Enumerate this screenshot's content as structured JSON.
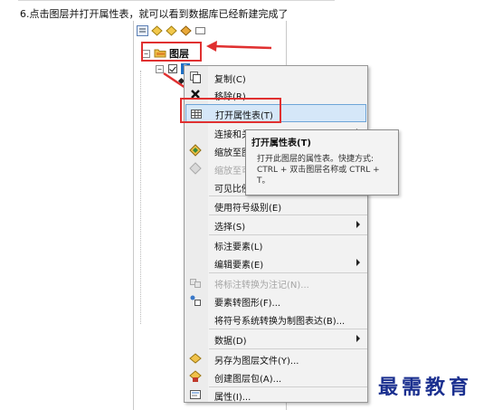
{
  "instruction": {
    "text": "6.点击图层并打开属性表，就可以看到数据库已经新建完成了"
  },
  "toc": {
    "group_label": "图层",
    "layer_chip": "P"
  },
  "menu": {
    "items": [
      {
        "label": "复制(C)",
        "icon": "copy-icon",
        "enabled": true,
        "submenu": false
      },
      {
        "label": "移除(R)",
        "icon": "remove-x-icon",
        "enabled": true,
        "submenu": false
      },
      {
        "label": "打开属性表(T)",
        "icon": "table-icon",
        "enabled": true,
        "submenu": false,
        "highlighted": true
      },
      {
        "label": "连接和关联(J)",
        "icon": "",
        "enabled": true,
        "submenu": true
      },
      {
        "label": "缩放至图层(Z)",
        "icon": "zoom-layer-icon",
        "enabled": true,
        "submenu": false
      },
      {
        "label": "缩放至可见(M)",
        "icon": "zoom-visible-icon",
        "enabled": false,
        "submenu": false
      },
      {
        "label": "可见比例范围(S)",
        "icon": "",
        "enabled": true,
        "submenu": true
      },
      {
        "label": "使用符号级别(E)",
        "icon": "",
        "enabled": true,
        "submenu": false
      },
      {
        "label": "选择(S)",
        "icon": "",
        "enabled": true,
        "submenu": true
      },
      {
        "label": "标注要素(L)",
        "icon": "",
        "enabled": true,
        "submenu": false
      },
      {
        "label": "编辑要素(E)",
        "icon": "",
        "enabled": true,
        "submenu": true
      },
      {
        "label": "将标注转换为注记(N)...",
        "icon": "convert-label-icon",
        "enabled": false,
        "submenu": false
      },
      {
        "label": "要素转图形(F)...",
        "icon": "feature-graphic-icon",
        "enabled": true,
        "submenu": false
      },
      {
        "label": "将符号系统转换为制图表达(B)...",
        "icon": "",
        "enabled": true,
        "submenu": false
      },
      {
        "label": "数据(D)",
        "icon": "",
        "enabled": true,
        "submenu": true
      },
      {
        "label": "另存为图层文件(Y)...",
        "icon": "layer-file-icon",
        "enabled": true,
        "submenu": false
      },
      {
        "label": "创建图层包(A)...",
        "icon": "layer-package-icon",
        "enabled": true,
        "submenu": false
      },
      {
        "label": "属性(I)...",
        "icon": "properties-icon",
        "enabled": true,
        "submenu": false
      }
    ]
  },
  "tooltip": {
    "title": "打开属性表(T)",
    "line1": "打开此图层的属性表。快捷方式:",
    "line2": "CTRL + 双击图层名称或 CTRL +",
    "line3": "T。"
  },
  "watermark": {
    "text": "最需教育"
  },
  "colors": {
    "annotation_red": "#e03030",
    "highlight_bg": "#d5e7f8",
    "highlight_border": "#6ea5d8",
    "watermark_blue": "#1a2f8f"
  }
}
